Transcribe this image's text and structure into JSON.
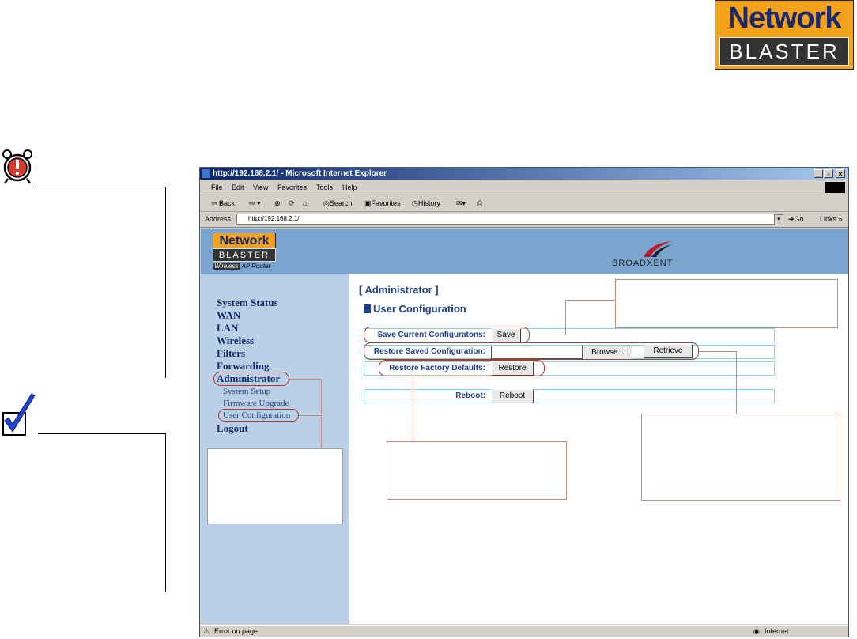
{
  "logo": {
    "top": "Network",
    "bottom": "BLASTER"
  },
  "browser": {
    "title": "http://192.168.2.1/ - Microsoft Internet Explorer",
    "menu": [
      "File",
      "Edit",
      "View",
      "Favorites",
      "Tools",
      "Help"
    ],
    "toolbar": {
      "back": "Back",
      "search": "Search",
      "favorites": "Favorites",
      "history": "History"
    },
    "address_label": "Address",
    "address_value": "http://192.168.2.1/",
    "go": "Go",
    "links": "Links",
    "status": "Error on page.",
    "zone": "Internet"
  },
  "page": {
    "logo_top": "Network",
    "logo_bottom": "BLASTER",
    "logo_sub_a": "Wireless",
    "logo_sub_b": "AP Router",
    "brand": "BROADXENT",
    "nav": [
      "System Status",
      "WAN",
      "LAN",
      "Wireless",
      "Filters",
      "Forwarding",
      "Administrator"
    ],
    "subnav": [
      "System Setup",
      "Firmware Upgrade",
      "User Configuration"
    ],
    "logout": "Logout",
    "section": "[ Administrator ]",
    "subsection": "User Configuration",
    "save_label": "Save Current Configuratons:",
    "save_btn": "Save",
    "restore_saved_label": "Restore Saved Configuration:",
    "browse_btn": "Browse...",
    "retrieve_btn": "Retrieve",
    "factory_label": "Restore Factory Defaults:",
    "restore_btn": "Restore",
    "reboot_label": "Reboot:",
    "reboot_btn": "Reboot"
  },
  "colors": {
    "accent": "#1f3f8f",
    "banner": "#7ba5cf",
    "sidebar": "#b9d0e6",
    "logo_orange": "#f4a21c",
    "highlight": "#b0392b"
  }
}
